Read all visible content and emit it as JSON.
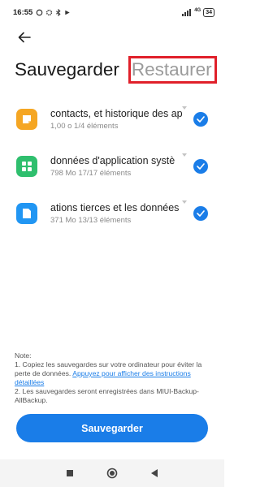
{
  "status_bar": {
    "time": "16:55",
    "network": "4G",
    "battery": "34"
  },
  "header": {
    "tab_backup": "Sauvegarder",
    "tab_restore": "Restaurer"
  },
  "items": [
    {
      "title": "contacts, et historique des ap",
      "subtitle": "1,00 o  1/4 éléments",
      "icon": "notes-icon",
      "color": "#f5a623"
    },
    {
      "title": "données d'application systè",
      "subtitle": "798 Mo  17/17 éléments",
      "icon": "apps-grid-icon",
      "color": "#2fbf6e"
    },
    {
      "title": "ations tierces et les données",
      "subtitle": "371 Mo  13/13 éléments",
      "icon": "document-icon",
      "color": "#2196f3"
    }
  ],
  "note": {
    "title": "Note:",
    "line1": "1. Copiez les sauvegardes sur votre ordinateur pour éviter la perte de données.",
    "link": "Appuyez pour afficher des instructions détaillées",
    "line2": "2. Les sauvegardes seront enregistrées dans MIUI-Backup-AllBackup."
  },
  "action": {
    "label": "Sauvegarder"
  },
  "colors": {
    "accent": "#1a7de8",
    "highlight_box": "#e0202a"
  }
}
